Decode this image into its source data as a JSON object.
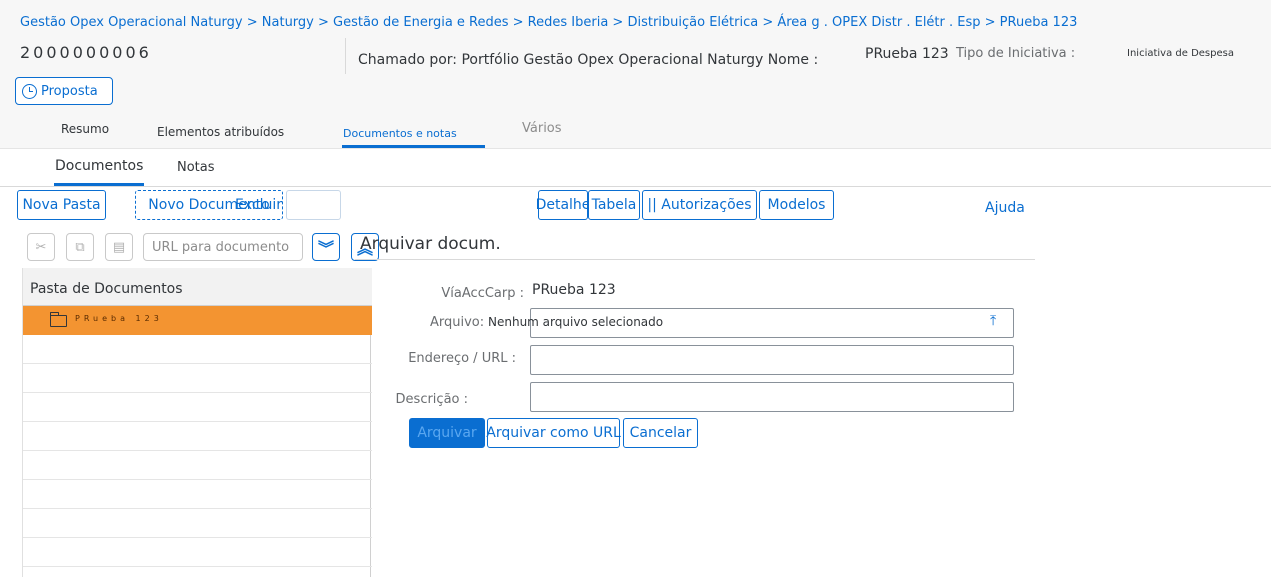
{
  "breadcrumb": "Gestão Opex Operacional Naturgy > Naturgy > Gestão de Energia e Redes > Redes Iberia > Distribuição Elétrica > Área g . OPEX Distr . Elétr . Esp > PRueba 123",
  "header": {
    "object_id": "2000000006",
    "called_by": "Chamado por: Portfólio Gestão Opex Operacional Naturgy Nome :",
    "name_value": "PRueba 123",
    "type_label": "Tipo de Iniciativa :",
    "type_value": "Iniciativa de Despesa",
    "status_button": "Proposta"
  },
  "tabs": [
    {
      "label": "Resumo"
    },
    {
      "label": "Elementos atribuídos"
    },
    {
      "label": "Documentos e notas"
    },
    {
      "label": "Vários"
    }
  ],
  "subtabs": [
    {
      "label": "Documentos"
    },
    {
      "label": "Notas"
    }
  ],
  "toolbar": {
    "new_folder": "Nova Pasta",
    "new_document": "Novo Documento",
    "delete": "Excluir",
    "detail": "Detalhe",
    "table": "Tabela",
    "authorizations": "|| Autorizações",
    "templates": "Modelos",
    "help": "Ajuda",
    "url_button": "URL para documento"
  },
  "tree": {
    "header": "Pasta de Documentos",
    "selected_folder": "PRueba 123"
  },
  "form": {
    "title": "Arquivar docum.",
    "path_label": "VíaAccCarp :",
    "path_value": "PRueba 123",
    "file_label": "Arquivo:",
    "file_value": "Nenhum arquivo selecionado",
    "url_label": "Endereço / URL :",
    "url_value": "",
    "desc_label": "Descrição :",
    "desc_value": "",
    "btn_archive": "Arquivar",
    "btn_archive_url": "Arquivar como URL",
    "btn_cancel": "Cancelar"
  },
  "colors": {
    "accent": "#0a6ed1",
    "selection": "#f39431"
  }
}
